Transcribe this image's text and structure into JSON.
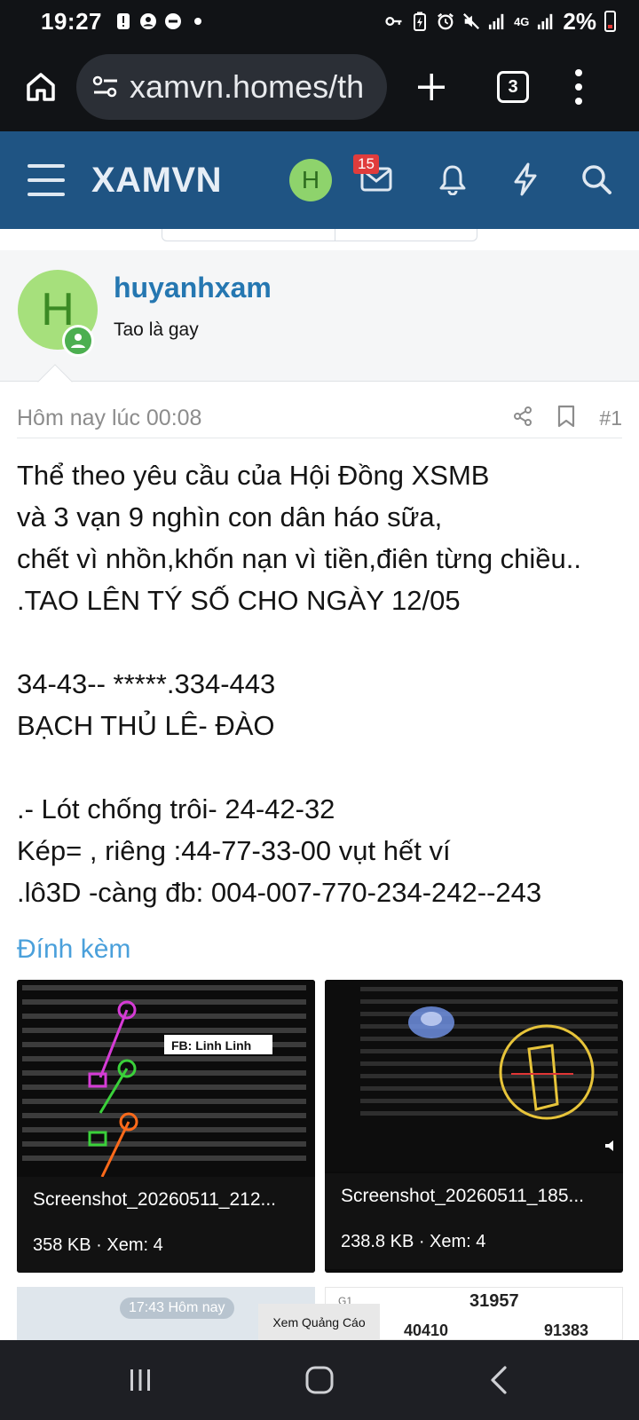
{
  "status_bar": {
    "time": "19:27",
    "battery": "2%",
    "network": "4G",
    "colors": {
      "background": "#111316",
      "battery_low": "#e53935"
    },
    "icons_left": [
      "alert-icon",
      "account-icon",
      "dnd-icon",
      "dot-icon"
    ],
    "icons_right": [
      "key-icon",
      "battery-saver-icon",
      "alarm-icon",
      "mute-icon",
      "signal-icon",
      "signal-icon"
    ]
  },
  "browser": {
    "url": "xamvn.homes/th",
    "tab_count": "3",
    "icons": [
      "home-icon",
      "site-settings-icon",
      "plus-icon",
      "tabs-icon",
      "more-icon"
    ]
  },
  "site_header": {
    "logo": "XAMVN",
    "avatar_letter": "H",
    "message_badge": "15",
    "colors": {
      "background": "#1f5483",
      "avatar": "#8ed36c",
      "badge": "#e03c3c"
    },
    "icons": [
      "menu-icon",
      "mail-icon",
      "bell-icon",
      "bolt-icon",
      "search-icon"
    ]
  },
  "user": {
    "avatar_letter": "H",
    "name": "huyanhxam",
    "title": "Tao là gay",
    "colors": {
      "name": "#2577b1",
      "avatar": "#a6e07c",
      "online": "#4caf50"
    }
  },
  "post": {
    "time": "Hôm nay lúc 00:08",
    "number": "#1",
    "lines": [
      "Thể theo yêu cầu của Hội Đồng XSMB",
      "và 3 vạn 9 nghìn con dân háo sữa,",
      "chết vì nhồn,khốn nạn vì tiền,điên từng chiều..",
      ".TAO LÊN TÝ SỐ CHO NGÀY 12/05",
      "",
      "34-43-- *****.334-443",
      "BẠCH THỦ LÊ- ĐÀO",
      "",
      ".- Lót chống trôi- 24-42-32",
      "Kép= , riêng :44-77-33-00 vụt hết ví",
      ".lô3D -càng đb: 004-007-770-234-242--243"
    ]
  },
  "attachments": {
    "title": "Đính kèm",
    "items": [
      {
        "name": "Screenshot_20260511_212...",
        "info": "358 KB · Xem: 4",
        "watermark": "FB: Linh Linh"
      },
      {
        "name": "Screenshot_20260511_185...",
        "info": "238.8 KB · Xem: 4"
      }
    ],
    "partial_3": {
      "pill": "17:43 Hôm nay"
    },
    "partial_4": {
      "label": "G1",
      "numbers": [
        "31957",
        "40410",
        "91383"
      ]
    }
  },
  "ad_button": "Xem Quảng Cáo",
  "nav_bar": {
    "icons": [
      "recents-icon",
      "home-nav-icon",
      "back-icon"
    ]
  }
}
